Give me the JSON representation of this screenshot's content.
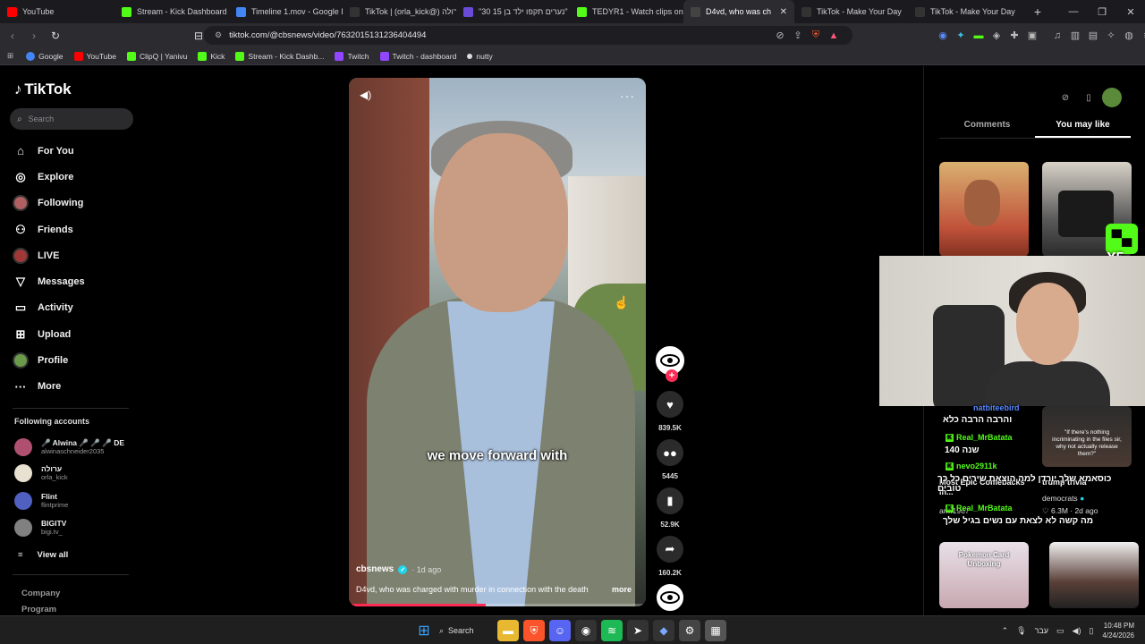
{
  "browser": {
    "tabs": [
      {
        "title": "YouTube",
        "color": "#ff0000",
        "active": false
      },
      {
        "title": "Stream - Kick Dashboard",
        "color": "#53fc18",
        "active": false
      },
      {
        "title": "Timeline 1.mov - Google D",
        "color": "#4285f4",
        "active": false
      },
      {
        "title": "TikTok | (orla_kick@) ערולה",
        "color": "#111111",
        "active": false
      },
      {
        "title": "\"30 נערים תקפו ילד בן 15\"",
        "color": "#6a4bd8",
        "active": false
      },
      {
        "title": "TEDYR1 - Watch clips on K",
        "color": "#53fc18",
        "active": false
      },
      {
        "title": "D4vd, who was ch",
        "color": "#111111",
        "active": true
      },
      {
        "title": "TikTok - Make Your Day",
        "color": "#111111",
        "active": false
      },
      {
        "title": "TikTok - Make Your Day",
        "color": "#111111",
        "active": false
      }
    ],
    "new_tab_label": "+",
    "url": "tiktok.com/@cbsnews/video/7632015131236404494",
    "bookmarks": [
      {
        "label": "Google",
        "color": "#4285f4"
      },
      {
        "label": "YouTube",
        "color": "#ff0000"
      },
      {
        "label": "ClipQ | Yanivu",
        "color": "#53fc18"
      },
      {
        "label": "Kick",
        "color": "#53fc18"
      },
      {
        "label": "Stream - Kick Dashb...",
        "color": "#53fc18"
      },
      {
        "label": "Twitch",
        "color": "#9146ff"
      },
      {
        "label": "Twitch - dashboard",
        "color": "#9146ff"
      },
      {
        "label": "nutty",
        "color": "#dddddd"
      }
    ]
  },
  "tiktok": {
    "logo": "TikTok",
    "search_placeholder": "Search",
    "nav": [
      {
        "label": "For You",
        "icon": "home-icon"
      },
      {
        "label": "Explore",
        "icon": "compass-icon"
      },
      {
        "label": "Following",
        "icon": "avatar-icon"
      },
      {
        "label": "Friends",
        "icon": "friends-icon"
      },
      {
        "label": "LIVE",
        "icon": "live-icon"
      },
      {
        "label": "Messages",
        "icon": "paper-plane-icon"
      },
      {
        "label": "Activity",
        "icon": "activity-icon"
      },
      {
        "label": "Upload",
        "icon": "plus-square-icon"
      },
      {
        "label": "Profile",
        "icon": "profile-icon"
      },
      {
        "label": "More",
        "icon": "more-icon"
      }
    ],
    "following_header": "Following accounts",
    "following": [
      {
        "name": "🎤 Alwina 🎤 🎤 🎤 DE",
        "handle": "alwinaschneider2035",
        "color": "#b05070"
      },
      {
        "name": "ערולה",
        "handle": "orla_kick",
        "color": "#e8e0d0"
      },
      {
        "name": "Flint",
        "handle": "flintprime",
        "color": "#5060c0"
      },
      {
        "name": "BIGITV",
        "handle": "bigi.tv_",
        "color": "#808080"
      }
    ],
    "view_all": "View all",
    "footer": [
      "Company",
      "Program"
    ]
  },
  "video": {
    "caption_text": "we move forward with",
    "author": "cbsnews",
    "posted": "· 1d ago",
    "description": "D4vd, who was charged with murder in connection with the death",
    "more_label": "more",
    "progress_fraction": 0.46,
    "likes": "839.5K",
    "comments": "5445",
    "saves": "52.9K",
    "shares": "160.2K"
  },
  "right_panel": {
    "tabs": [
      "Comments",
      "You may like"
    ],
    "active_tab": "You may like",
    "thumb_captions": [
      "Most Epic Comebacks in...",
      "trump trivia"
    ],
    "thumb_authors": [
      "arm1987",
      "democrats"
    ],
    "thumb_meta_2": "6.3M · 2d ago",
    "thumb_text_3": "Pokemon Card Unboxing",
    "thumb_quote": "\"If there's nothing incriminating in the files sir, why not actually release them?\""
  },
  "stream_overlay": {
    "badge": "X5",
    "chat": [
      {
        "user": "natbiteebird",
        "msg": "",
        "color": "blue"
      },
      {
        "user": "",
        "msg": "והרבה הרבה כלא",
        "color": "white"
      },
      {
        "user": "Real_MrBatata",
        "msg": "",
        "color": "green"
      },
      {
        "user": "",
        "msg": "140 שנה",
        "color": "white"
      },
      {
        "user": "nevo2911k",
        "msg": "",
        "color": "green"
      },
      {
        "user": "",
        "msg": "כוסאמא שלך יורדן למה הוצאת שירים כל כך טובים",
        "color": "white"
      },
      {
        "user": "Real_MrBatata",
        "msg": "",
        "color": "green"
      },
      {
        "user": "",
        "msg": "מה קשה לא לצאת עם נשים בגיל שלך",
        "color": "white"
      }
    ]
  },
  "taskbar": {
    "search_label": "Search",
    "lang": "עבר",
    "time": "10:48 PM",
    "date": "4/24/2026"
  }
}
